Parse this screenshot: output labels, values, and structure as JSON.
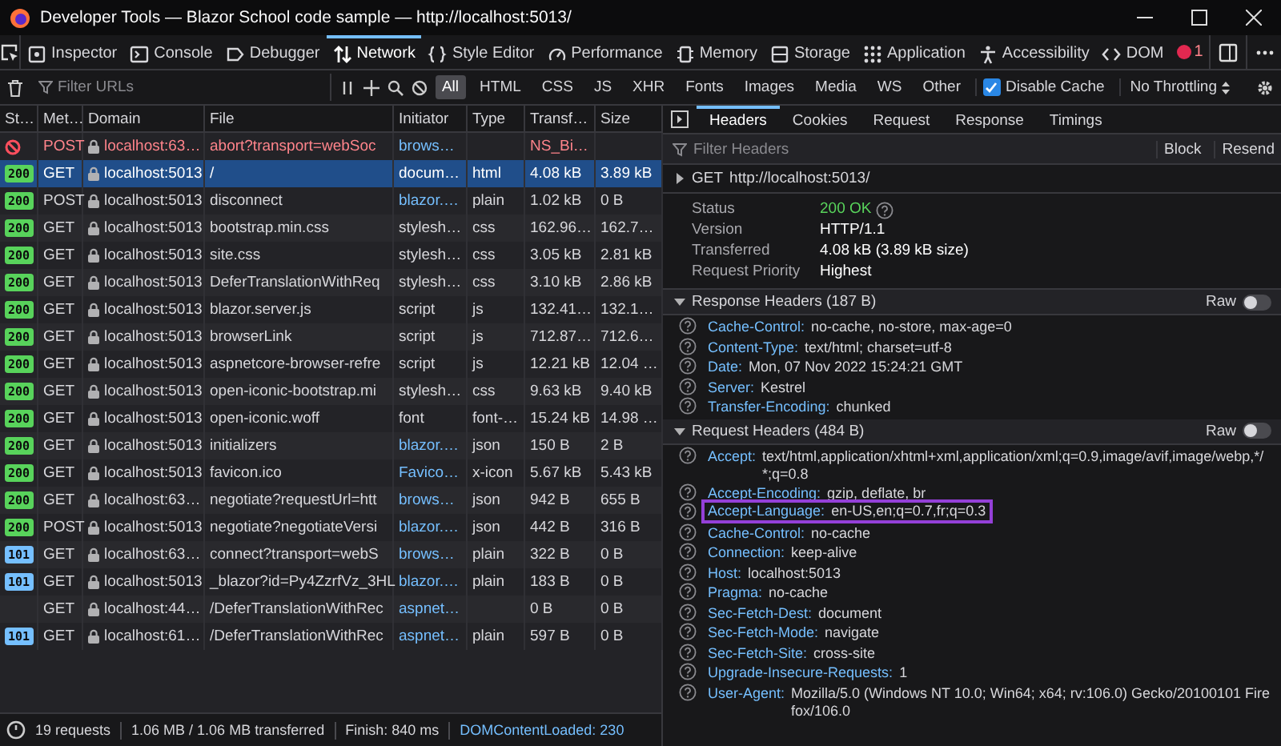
{
  "window": {
    "title": "Developer Tools — Blazor School code sample — http://localhost:5013/"
  },
  "devtools_tabs": [
    {
      "label": "Inspector",
      "selected": false
    },
    {
      "label": "Console",
      "selected": false
    },
    {
      "label": "Debugger",
      "selected": false
    },
    {
      "label": "Network",
      "selected": true
    },
    {
      "label": "Style Editor",
      "selected": false
    },
    {
      "label": "Performance",
      "selected": false
    },
    {
      "label": "Memory",
      "selected": false
    },
    {
      "label": "Storage",
      "selected": false
    },
    {
      "label": "Application",
      "selected": false
    },
    {
      "label": "Accessibility",
      "selected": false
    },
    {
      "label": "DOM",
      "selected": false
    }
  ],
  "error_count": "1",
  "network_toolbar": {
    "filter": {
      "placeholder": "Filter URLs"
    },
    "type_filters": [
      {
        "label": "All",
        "selected": true
      },
      {
        "label": "HTML",
        "selected": false
      },
      {
        "label": "CSS",
        "selected": false
      },
      {
        "label": "JS",
        "selected": false
      },
      {
        "label": "XHR",
        "selected": false
      },
      {
        "label": "Fonts",
        "selected": false
      },
      {
        "label": "Images",
        "selected": false
      },
      {
        "label": "Media",
        "selected": false
      },
      {
        "label": "WS",
        "selected": false
      },
      {
        "label": "Other",
        "selected": false
      }
    ],
    "disable_cache": {
      "label": "Disable Cache",
      "checked": true
    },
    "throttling": {
      "value": "No Throttling"
    }
  },
  "table": {
    "columns": [
      "St…",
      "Met…",
      "Domain",
      "File",
      "Initiator",
      "Type",
      "Transf…",
      "Size"
    ],
    "rows": [
      {
        "kind": "blocked",
        "method": "POST",
        "domain": "localhost:63…",
        "file": "abort?transport=webSoc",
        "initiator": "brows…",
        "initiator_link": true,
        "transferred": "NS_Bi…",
        "selected": false
      },
      {
        "kind": "ok",
        "status": "200",
        "method": "GET",
        "domain": "localhost:5013",
        "file": "/",
        "initiator": "docum…",
        "initiator_link": false,
        "type": "html",
        "transferred": "4.08 kB",
        "size": "3.89 kB",
        "selected": true
      },
      {
        "kind": "ok",
        "status": "200",
        "method": "POST",
        "domain": "localhost:5013",
        "file": "disconnect",
        "initiator": "blazor.…",
        "initiator_link": true,
        "type": "plain",
        "transferred": "1.02 kB",
        "size": "0 B",
        "selected": false
      },
      {
        "kind": "ok",
        "status": "200",
        "method": "GET",
        "domain": "localhost:5013",
        "file": "bootstrap.min.css",
        "initiator": "stylesh…",
        "initiator_link": false,
        "type": "css",
        "transferred": "162.96…",
        "size": "162.7…",
        "selected": false
      },
      {
        "kind": "ok",
        "status": "200",
        "method": "GET",
        "domain": "localhost:5013",
        "file": "site.css",
        "initiator": "stylesh…",
        "initiator_link": false,
        "type": "css",
        "transferred": "3.05 kB",
        "size": "2.81 kB",
        "selected": false
      },
      {
        "kind": "ok",
        "status": "200",
        "method": "GET",
        "domain": "localhost:5013",
        "file": "DeferTranslationWithReq",
        "initiator": "stylesh…",
        "initiator_link": false,
        "type": "css",
        "transferred": "3.10 kB",
        "size": "2.86 kB",
        "selected": false
      },
      {
        "kind": "ok",
        "status": "200",
        "method": "GET",
        "domain": "localhost:5013",
        "file": "blazor.server.js",
        "initiator": "script",
        "initiator_link": false,
        "type": "js",
        "transferred": "132.41…",
        "size": "132.1…",
        "selected": false
      },
      {
        "kind": "ok",
        "status": "200",
        "method": "GET",
        "domain": "localhost:5013",
        "file": "browserLink",
        "initiator": "script",
        "initiator_link": false,
        "type": "js",
        "transferred": "712.87…",
        "size": "712.6…",
        "selected": false
      },
      {
        "kind": "ok",
        "status": "200",
        "method": "GET",
        "domain": "localhost:5013",
        "file": "aspnetcore-browser-refre",
        "initiator": "script",
        "initiator_link": false,
        "type": "js",
        "transferred": "12.21 kB",
        "size": "12.04 …",
        "selected": false
      },
      {
        "kind": "ok",
        "status": "200",
        "method": "GET",
        "domain": "localhost:5013",
        "file": "open-iconic-bootstrap.mi",
        "initiator": "stylesh…",
        "initiator_link": false,
        "type": "css",
        "transferred": "9.63 kB",
        "size": "9.40 kB",
        "selected": false
      },
      {
        "kind": "ok",
        "status": "200",
        "method": "GET",
        "domain": "localhost:5013",
        "file": "open-iconic.woff",
        "initiator": "font",
        "initiator_link": false,
        "type": "font-…",
        "transferred": "15.24 kB",
        "size": "14.98 …",
        "selected": false
      },
      {
        "kind": "ok",
        "status": "200",
        "method": "GET",
        "domain": "localhost:5013",
        "file": "initializers",
        "initiator": "blazor.…",
        "initiator_link": true,
        "type": "json",
        "transferred": "150 B",
        "size": "2 B",
        "selected": false
      },
      {
        "kind": "ok",
        "status": "200",
        "method": "GET",
        "domain": "localhost:5013",
        "file": "favicon.ico",
        "initiator": "Favico…",
        "initiator_link": true,
        "type": "x-icon",
        "transferred": "5.67 kB",
        "size": "5.43 kB",
        "selected": false
      },
      {
        "kind": "ok",
        "status": "200",
        "method": "GET",
        "domain": "localhost:63…",
        "file": "negotiate?requestUrl=htt",
        "initiator": "brows…",
        "initiator_link": true,
        "type": "json",
        "transferred": "942 B",
        "size": "655 B",
        "selected": false
      },
      {
        "kind": "ok",
        "status": "200",
        "method": "POST",
        "domain": "localhost:5013",
        "file": "negotiate?negotiateVersi",
        "initiator": "blazor.…",
        "initiator_link": true,
        "type": "json",
        "transferred": "442 B",
        "size": "316 B",
        "selected": false
      },
      {
        "kind": "switching",
        "status": "101",
        "method": "GET",
        "domain": "localhost:63…",
        "file": "connect?transport=webS",
        "initiator": "brows…",
        "initiator_link": true,
        "type": "plain",
        "transferred": "322 B",
        "size": "0 B",
        "selected": false
      },
      {
        "kind": "switching",
        "status": "101",
        "method": "GET",
        "domain": "localhost:5013",
        "file": "_blazor?id=Py4ZzrfVz_3HL",
        "initiator": "blazor.…",
        "initiator_link": true,
        "type": "plain",
        "transferred": "183 B",
        "size": "0 B",
        "selected": false
      },
      {
        "kind": "pending",
        "method": "GET",
        "domain": "localhost:44…",
        "file": "/DeferTranslationWithRec",
        "initiator": "aspnet…",
        "initiator_link": true,
        "transferred": "0 B",
        "size": "0 B",
        "selected": false
      },
      {
        "kind": "switching",
        "status": "101",
        "method": "GET",
        "domain": "localhost:61…",
        "file": "/DeferTranslationWithRec",
        "initiator": "aspnet…",
        "initiator_link": true,
        "type": "plain",
        "transferred": "597 B",
        "size": "0 B",
        "selected": false
      }
    ]
  },
  "status_bar": {
    "requests": "19 requests",
    "transferred": "1.06 MB / 1.06 MB transferred",
    "finish": "Finish: 840 ms",
    "dom_content_loaded": "DOMContentLoaded: 230"
  },
  "details": {
    "tabs": [
      {
        "label": "Headers",
        "selected": true
      },
      {
        "label": "Cookies",
        "selected": false
      },
      {
        "label": "Request",
        "selected": false
      },
      {
        "label": "Response",
        "selected": false
      },
      {
        "label": "Timings",
        "selected": false
      }
    ],
    "filter": {
      "placeholder": "Filter Headers"
    },
    "buttons": [
      "Block",
      "Resend"
    ],
    "request_line": {
      "method": "GET",
      "url": "http://localhost:5013/",
      "expanded": false
    },
    "summary": [
      {
        "label": "Status",
        "value": "200 OK",
        "kind": "status"
      },
      {
        "label": "Version",
        "value": "HTTP/1.1",
        "kind": "text"
      },
      {
        "label": "Transferred",
        "value": "4.08 kB (3.89 kB size)",
        "kind": "text"
      },
      {
        "label": "Request Priority",
        "value": "Highest",
        "kind": "text"
      }
    ],
    "response_headers": {
      "title": "Response Headers (187 B)",
      "expanded": true,
      "raw_label": "Raw",
      "raw": false,
      "headers": [
        {
          "name": "Cache-Control:",
          "value": "no-cache, no-store, max-age=0"
        },
        {
          "name": "Content-Type:",
          "value": "text/html; charset=utf-8"
        },
        {
          "name": "Date:",
          "value": "Mon, 07 Nov 2022 15:24:21 GMT"
        },
        {
          "name": "Server:",
          "value": "Kestrel"
        },
        {
          "name": "Transfer-Encoding:",
          "value": "chunked"
        }
      ]
    },
    "request_headers": {
      "title": "Request Headers (484 B)",
      "expanded": true,
      "raw_label": "Raw",
      "raw": false,
      "headers": [
        {
          "name": "Accept:",
          "value": "text/html,application/xhtml+xml,application/xml;q=0.9,image/avif,image/webp,*/*;q=0.8",
          "highlighted": false
        },
        {
          "name": "Accept-Encoding:",
          "value": "gzip, deflate, br",
          "highlighted": false
        },
        {
          "name": "Accept-Language:",
          "value": "en-US,en;q=0.7,fr;q=0.3",
          "highlighted": true
        },
        {
          "name": "Cache-Control:",
          "value": "no-cache",
          "highlighted": false
        },
        {
          "name": "Connection:",
          "value": "keep-alive",
          "highlighted": false
        },
        {
          "name": "Host:",
          "value": "localhost:5013",
          "highlighted": false
        },
        {
          "name": "Pragma:",
          "value": "no-cache",
          "highlighted": false
        },
        {
          "name": "Sec-Fetch-Dest:",
          "value": "document",
          "highlighted": false
        },
        {
          "name": "Sec-Fetch-Mode:",
          "value": "navigate",
          "highlighted": false
        },
        {
          "name": "Sec-Fetch-Site:",
          "value": "cross-site",
          "highlighted": false
        },
        {
          "name": "Upgrade-Insecure-Requests:",
          "value": "1",
          "highlighted": false
        },
        {
          "name": "User-Agent:",
          "value": "Mozilla/5.0 (Windows NT 10.0; Win64; x64; rv:106.0) Gecko/20100101 Firefox/106.0",
          "highlighted": false
        }
      ]
    }
  }
}
